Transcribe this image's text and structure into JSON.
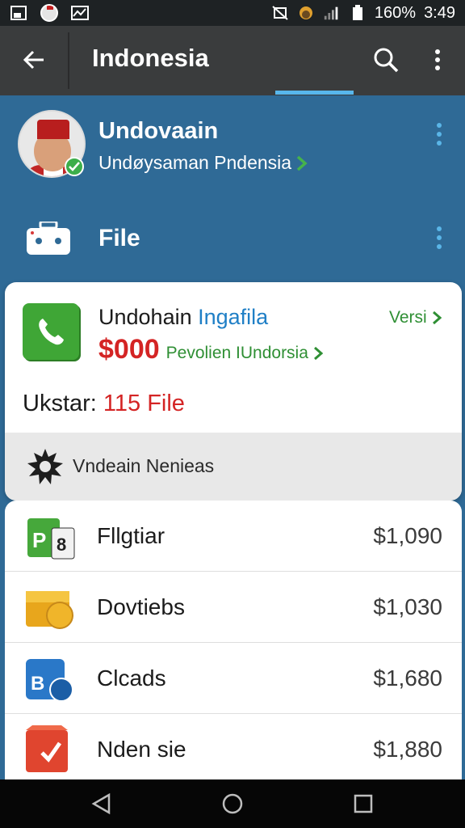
{
  "status_bar": {
    "battery": "160%",
    "time": "3:49",
    "icons": [
      "image-icon",
      "avatar-icon",
      "chart-icon",
      "mute-icon",
      "weather-icon",
      "signal-icon",
      "battery-icon"
    ]
  },
  "app_bar": {
    "title": "Indonesia",
    "icons": [
      "back-arrow-icon",
      "search-icon",
      "more-vert-icon"
    ],
    "accent": "#58b7ec"
  },
  "profile": {
    "name": "Undovaain",
    "subtitle": "Undøysaman Pndensia"
  },
  "file_row": {
    "label": "File"
  },
  "card": {
    "title_part1": "Undohain",
    "title_part2": "Ingafila",
    "version_link": "Versi",
    "price": "$000",
    "price_sub": "Pevolien IUndorsia",
    "stat_label": "Ukstar:",
    "stat_value": "115 File",
    "footer_label": "Vndeain Nenieas",
    "colors": {
      "price": "#d42424",
      "link": "#2f8f34",
      "accent": "#1f7fc6"
    }
  },
  "list": {
    "items": [
      {
        "label": "Fllgtiar",
        "price": "$1,090",
        "icon": "green-puzzle-icon"
      },
      {
        "label": "Dovtiebs",
        "price": "$1,030",
        "icon": "gold-coin-icon"
      },
      {
        "label": "Clcads",
        "price": "$1,680",
        "icon": "blue-cube-icon"
      },
      {
        "label": "Nden sie",
        "price": "$1,880",
        "icon": "red-box-icon"
      }
    ]
  },
  "nav_bar": {
    "icons": [
      "back-triangle-icon",
      "home-circle-icon",
      "recents-square-icon"
    ]
  }
}
